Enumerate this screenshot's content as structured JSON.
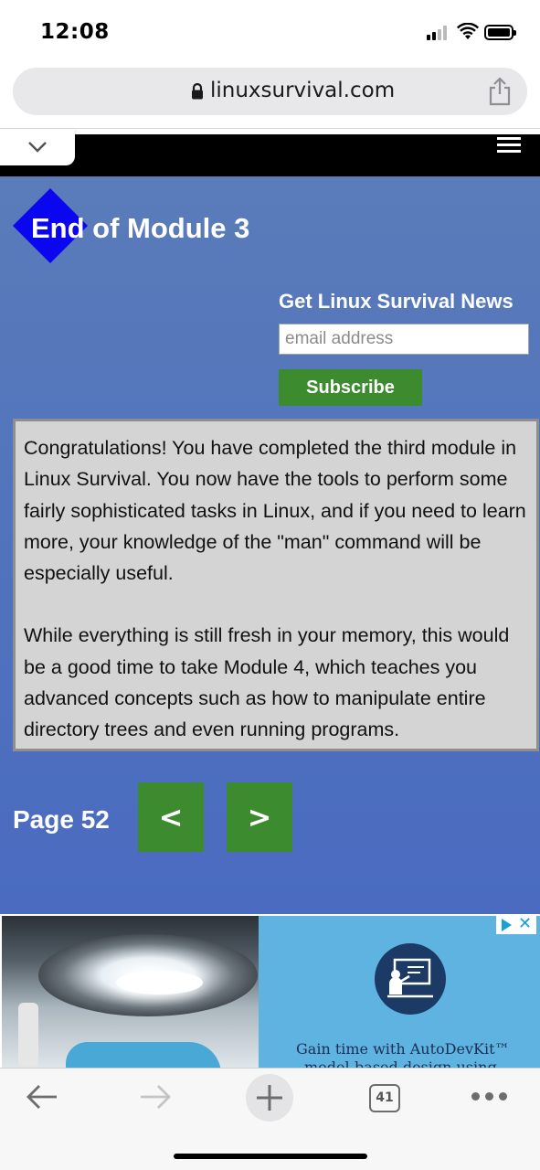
{
  "status_bar": {
    "time": "12:08"
  },
  "browser": {
    "url": "linuxsurvival.com"
  },
  "page": {
    "title": "End of Module 3",
    "newsletter": {
      "heading": "Get Linux Survival News",
      "email_placeholder": "email address",
      "subscribe_label": "Subscribe"
    },
    "content": {
      "paragraphs": [
        "Congratulations! You have completed the third module in Linux Survival. You now have the tools to perform some fairly sophisticated tasks in Linux, and if you need to learn more, your knowledge of the \"man\" command will be especially useful.",
        "While everything is still fresh in your memory, this would be a good time to take Module 4, which teaches you advanced concepts such as how to manipulate entire directory trees and even running programs."
      ]
    },
    "pagination": {
      "label": "Page 52",
      "prev_label": "<",
      "next_label": ">"
    }
  },
  "ad": {
    "text_line1": "Gain time with AutoDevKit™",
    "text_line2": "model-based design using"
  },
  "toolbar": {
    "tab_count": "41"
  },
  "colors": {
    "page_blue": "#5274bc",
    "button_green": "#3d8b2f",
    "diamond_blue": "#0a06f0",
    "content_gray": "#d4d4d4"
  }
}
